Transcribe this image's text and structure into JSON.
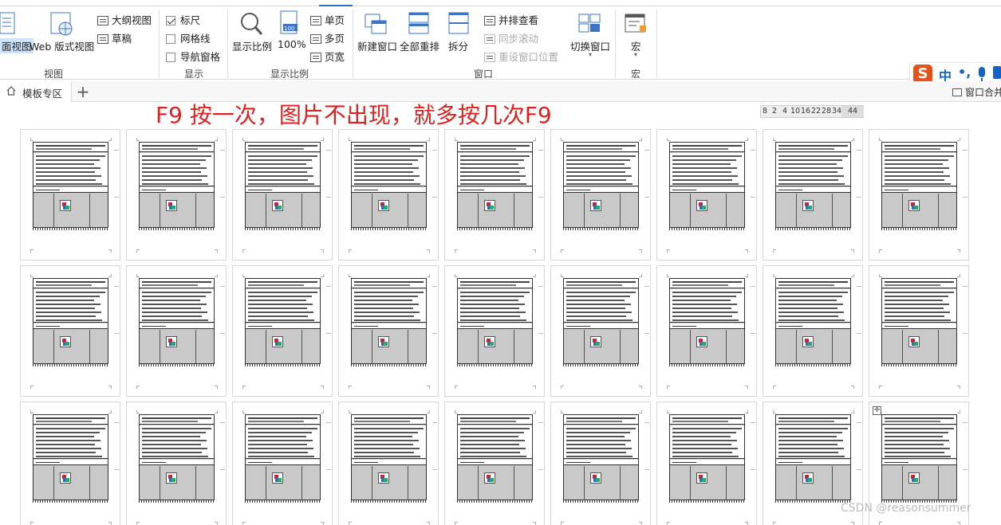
{
  "ribbon": {
    "view_group": {
      "read_view_label": "面视图",
      "web_view_label": "Web 版式视图",
      "outline_label": "大纲视图",
      "draft_label": "草稿",
      "group_label": "视图"
    },
    "show_group": {
      "ruler_label": "标尺",
      "ruler_checked": true,
      "gridlines_label": "网格线",
      "gridlines_checked": false,
      "nav_pane_label": "导航窗格",
      "nav_pane_checked": false,
      "group_label": "显示"
    },
    "zoom_group": {
      "zoom_label": "显示比例",
      "zoom100_label": "100%",
      "single_page_label": "单页",
      "multi_page_label": "多页",
      "page_width_label": "页宽",
      "group_label": "显示比例"
    },
    "window_group": {
      "new_window_label": "新建窗口",
      "arrange_all_label": "全部重排",
      "split_label": "拆分",
      "side_by_side_label": "并排查看",
      "sync_scroll_label": "同步滚动",
      "reset_position_label": "重设窗口位置",
      "switch_window_label": "切换窗口",
      "group_label": "窗口"
    },
    "macro_group": {
      "macro_label": "宏",
      "group_label": "宏"
    }
  },
  "ime": {
    "logo": "S",
    "mode": "中",
    "punct": "•,"
  },
  "doc_tabs": {
    "active_tab": "模板专区",
    "add_label": "+",
    "right_label": "窗口合并"
  },
  "annotation": "F9  按一次，图片不出现，就多按几次F9",
  "ruler": {
    "values": [
      "8",
      "2",
      "4",
      "10",
      "16",
      "22",
      "28",
      "34"
    ],
    "end_value": "44"
  },
  "pages": {
    "rows": 3,
    "cols": 9
  },
  "watermark": "CSDN @reasonsummer"
}
